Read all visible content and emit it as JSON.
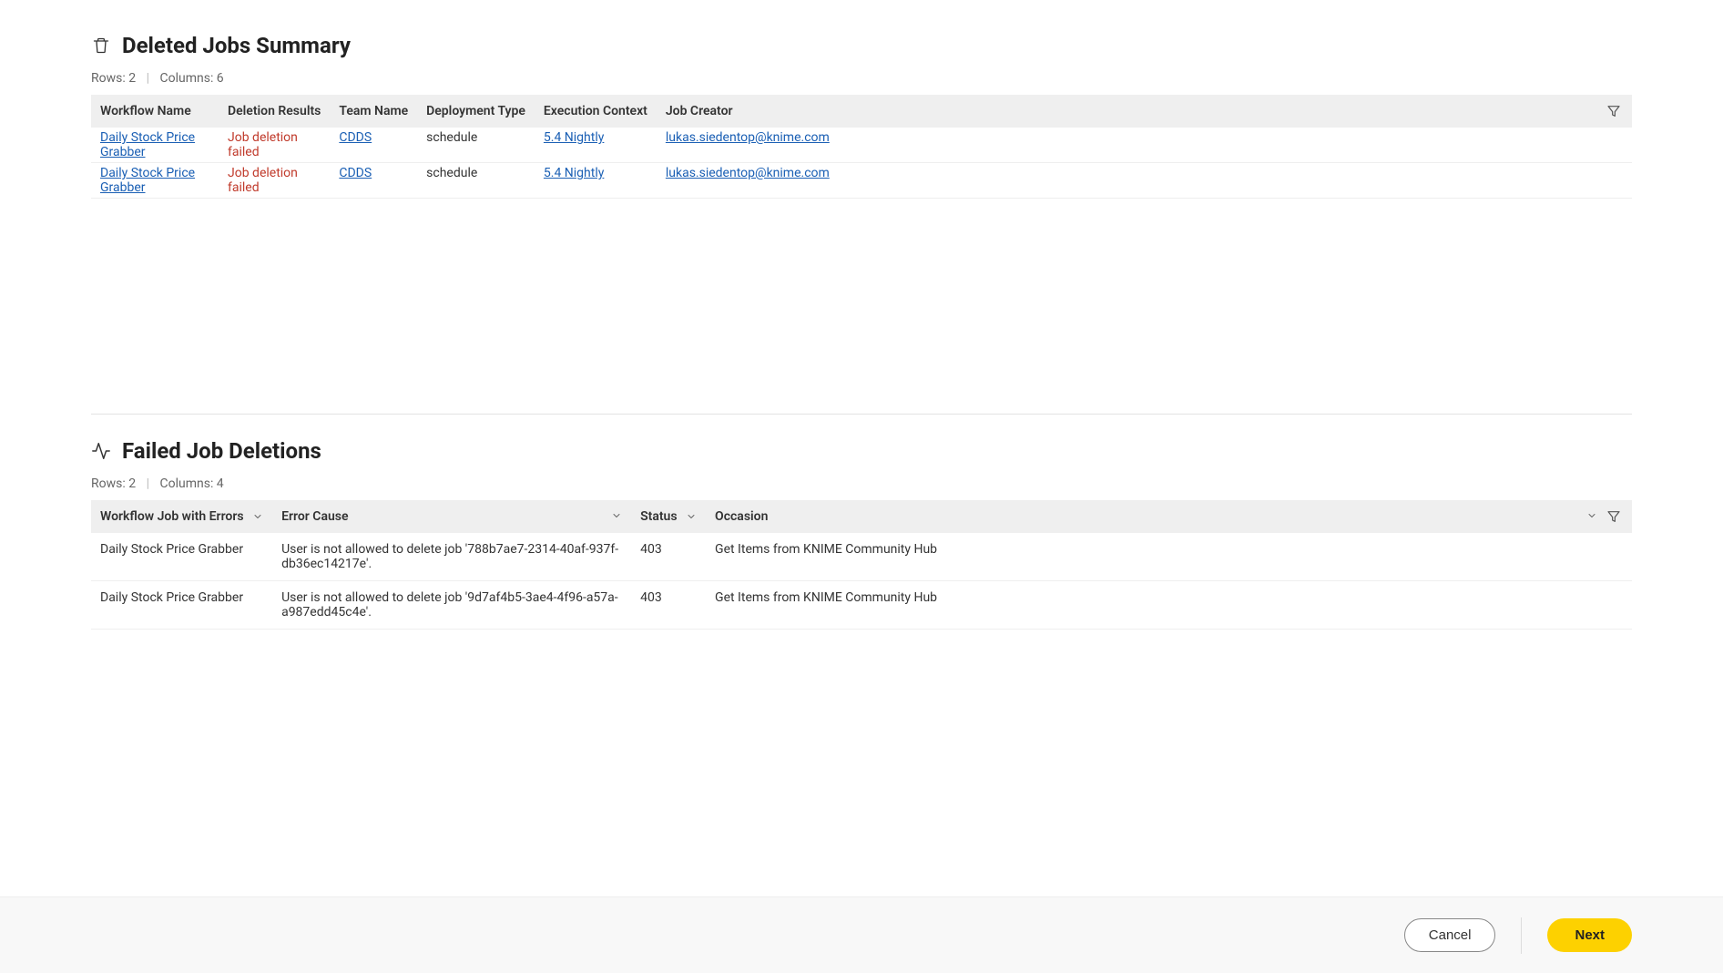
{
  "section1": {
    "title": "Deleted Jobs Summary",
    "meta_rows": "Rows: 2",
    "meta_cols": "Columns: 6",
    "columns": {
      "workflow_name": "Workflow Name",
      "deletion_results": "Deletion Results",
      "team_name": "Team Name",
      "deployment_type": "Deployment Type",
      "execution_context": "Execution Context",
      "job_creator": "Job Creator"
    },
    "rows": [
      {
        "workflow_name": "Daily Stock Price Grabber",
        "deletion_results": "Job deletion failed",
        "team_name": "CDDS",
        "deployment_type": "schedule",
        "execution_context": "5.4 Nightly",
        "job_creator": "lukas.siedentop@knime.com"
      },
      {
        "workflow_name": "Daily Stock Price Grabber",
        "deletion_results": "Job deletion failed",
        "team_name": "CDDS",
        "deployment_type": "schedule",
        "execution_context": "5.4 Nightly",
        "job_creator": "lukas.siedentop@knime.com"
      }
    ]
  },
  "section2": {
    "title": "Failed Job Deletions",
    "meta_rows": "Rows: 2",
    "meta_cols": "Columns: 4",
    "columns": {
      "workflow_job": "Workflow Job with Errors",
      "error_cause": "Error Cause",
      "status": "Status",
      "occasion": "Occasion"
    },
    "rows": [
      {
        "workflow_job": "Daily Stock Price Grabber",
        "error_cause": "User is not allowed to delete job '788b7ae7-2314-40af-937f-db36ec14217e'.",
        "status": "403",
        "occasion": "Get Items from KNIME Community Hub"
      },
      {
        "workflow_job": "Daily Stock Price Grabber",
        "error_cause": "User is not allowed to delete job '9d7af4b5-3ae4-4f96-a57a-a987edd45c4e'.",
        "status": "403",
        "occasion": "Get Items from KNIME Community Hub"
      }
    ]
  },
  "footer": {
    "cancel": "Cancel",
    "next": "Next"
  }
}
